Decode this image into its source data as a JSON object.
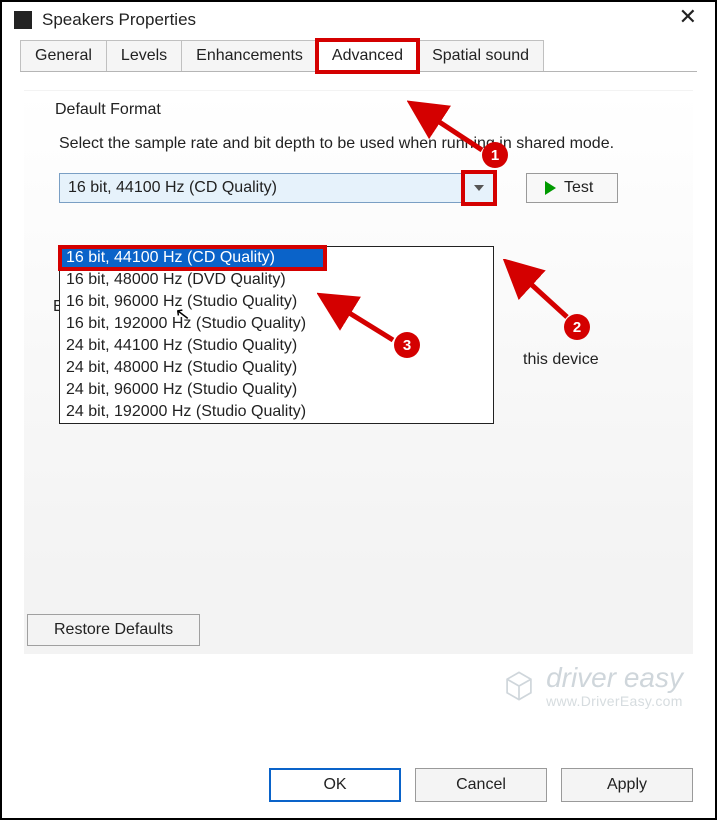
{
  "window": {
    "title": "Speakers Properties"
  },
  "tabs": {
    "items": [
      "General",
      "Levels",
      "Enhancements",
      "Advanced",
      "Spatial sound"
    ],
    "active_index": 3
  },
  "section": {
    "title": "Default Format",
    "description": "Select the sample rate and bit depth to be used when running in shared mode."
  },
  "combo": {
    "value": "16 bit, 44100 Hz (CD Quality)",
    "options": [
      "16 bit, 44100 Hz (CD Quality)",
      "16 bit, 48000 Hz (DVD Quality)",
      "16 bit, 96000 Hz (Studio Quality)",
      "16 bit, 192000 Hz (Studio Quality)",
      "24 bit, 44100 Hz (Studio Quality)",
      "24 bit, 48000 Hz (Studio Quality)",
      "24 bit, 96000 Hz (Studio Quality)",
      "24 bit, 192000 Hz (Studio Quality)"
    ],
    "selected_index": 0
  },
  "buttons": {
    "test": "Test",
    "restore": "Restore Defaults",
    "ok": "OK",
    "cancel": "Cancel",
    "apply": "Apply"
  },
  "peek_text": "this device",
  "annotations": {
    "badges": [
      "1",
      "2",
      "3"
    ]
  },
  "watermark": {
    "brand": "driver easy",
    "url": "www.DriverEasy.com"
  },
  "colors": {
    "accent_red": "#d40000",
    "accent_blue": "#0a63c9",
    "play_green": "#009a00"
  }
}
